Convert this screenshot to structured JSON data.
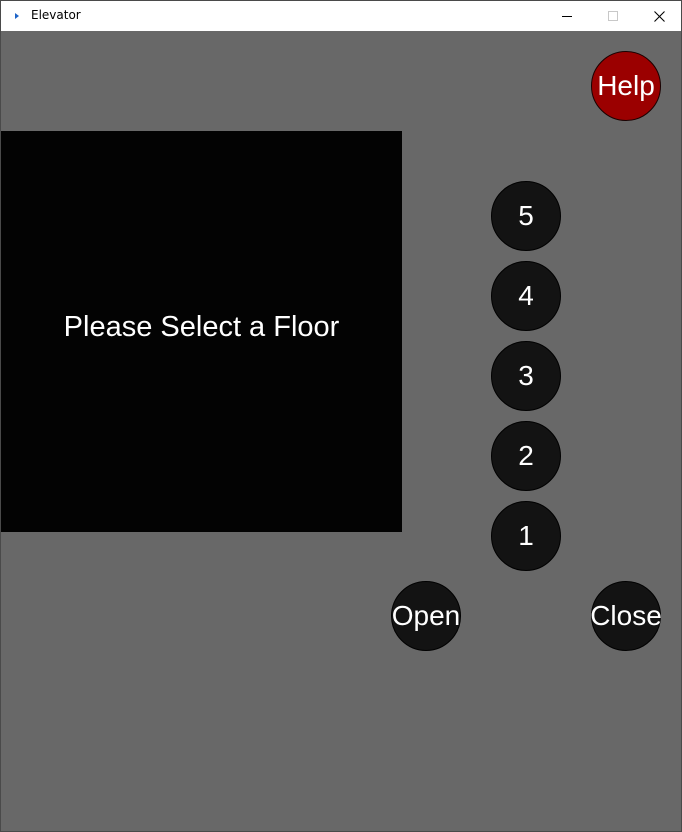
{
  "window": {
    "title": "Elevator",
    "icon": "app-arrow-icon",
    "controls": [
      "minimize-icon",
      "maximize-icon",
      "close-icon"
    ]
  },
  "display": {
    "message": "Please Select a Floor"
  },
  "buttons": {
    "help": "Help",
    "floors": [
      "5",
      "4",
      "3",
      "2",
      "1"
    ],
    "open": "Open",
    "close": "Close"
  },
  "colors": {
    "background": "#686868",
    "display": "#030303",
    "button": "#131313",
    "help_button": "#9b0000",
    "text": "#ffffff",
    "app_icon": "#1e64c8"
  }
}
